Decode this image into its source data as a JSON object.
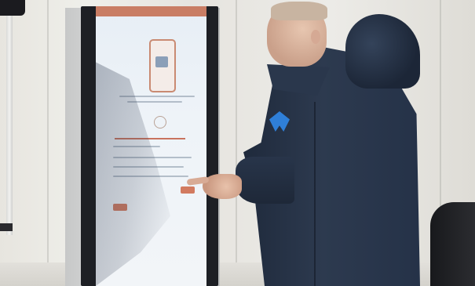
{
  "scene": {
    "description_colors": {
      "tent": "#e9e7e2",
      "kiosk_bezel": "#1d1f24",
      "screen_bg": "#eef3f8",
      "screen_accent": "#c97d64",
      "coat": "#2d3a4f",
      "ribbon": "#2f7fd8"
    },
    "icons": [
      "phone-illustration-icon",
      "circle-icon"
    ]
  }
}
